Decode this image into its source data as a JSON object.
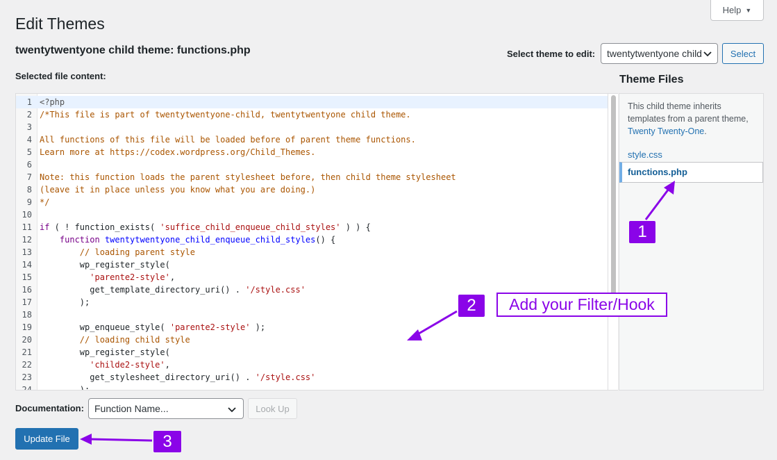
{
  "header": {
    "help_label": "Help",
    "page_title": "Edit Themes",
    "file_heading": "twentytwentyone child theme: functions.php",
    "select_theme_label": "Select theme to edit:",
    "select_theme_value": "twentytwentyone child theme",
    "select_button": "Select"
  },
  "editor": {
    "label": "Selected file content:",
    "lines": [
      {
        "n": "1",
        "spans": [
          {
            "c": "c-meta",
            "t": "<?php"
          }
        ]
      },
      {
        "n": "2",
        "spans": [
          {
            "c": "c-comment",
            "t": "/*This file is part of twentytwentyone-child, twentytwentyone child theme."
          }
        ]
      },
      {
        "n": "3",
        "spans": []
      },
      {
        "n": "4",
        "spans": [
          {
            "c": "c-comment",
            "t": "All functions of this file will be loaded before of parent theme functions."
          }
        ]
      },
      {
        "n": "5",
        "spans": [
          {
            "c": "c-comment",
            "t": "Learn more at https://codex.wordpress.org/Child_Themes."
          }
        ]
      },
      {
        "n": "6",
        "spans": []
      },
      {
        "n": "7",
        "spans": [
          {
            "c": "c-comment",
            "t": "Note: this function loads the parent stylesheet before, then child theme stylesheet"
          }
        ]
      },
      {
        "n": "8",
        "spans": [
          {
            "c": "c-comment",
            "t": "(leave it in place unless you know what you are doing.)"
          }
        ]
      },
      {
        "n": "9",
        "spans": [
          {
            "c": "c-comment",
            "t": "*/"
          }
        ]
      },
      {
        "n": "10",
        "spans": []
      },
      {
        "n": "11",
        "spans": [
          {
            "c": "c-kw",
            "t": "if"
          },
          {
            "c": "",
            "t": " ( ! function_exists( "
          },
          {
            "c": "c-str",
            "t": "'suffice_child_enqueue_child_styles'"
          },
          {
            "c": "",
            "t": " ) ) {"
          }
        ]
      },
      {
        "n": "12",
        "spans": [
          {
            "c": "",
            "t": "    "
          },
          {
            "c": "c-kw",
            "t": "function"
          },
          {
            "c": "",
            "t": " "
          },
          {
            "c": "c-def",
            "t": "twentytwentyone_child_enqueue_child_styles"
          },
          {
            "c": "",
            "t": "() {"
          }
        ]
      },
      {
        "n": "13",
        "spans": [
          {
            "c": "",
            "t": "        "
          },
          {
            "c": "c-comment",
            "t": "// loading parent style"
          }
        ]
      },
      {
        "n": "14",
        "spans": [
          {
            "c": "",
            "t": "        wp_register_style("
          }
        ]
      },
      {
        "n": "15",
        "spans": [
          {
            "c": "",
            "t": "          "
          },
          {
            "c": "c-str",
            "t": "'parente2-style'"
          },
          {
            "c": "",
            "t": ","
          }
        ]
      },
      {
        "n": "16",
        "spans": [
          {
            "c": "",
            "t": "          get_template_directory_uri() . "
          },
          {
            "c": "c-str",
            "t": "'/style.css'"
          }
        ]
      },
      {
        "n": "17",
        "spans": [
          {
            "c": "",
            "t": "        );"
          }
        ]
      },
      {
        "n": "18",
        "spans": []
      },
      {
        "n": "19",
        "spans": [
          {
            "c": "",
            "t": "        wp_enqueue_style( "
          },
          {
            "c": "c-str",
            "t": "'parente2-style'"
          },
          {
            "c": "",
            "t": " );"
          }
        ]
      },
      {
        "n": "20",
        "spans": [
          {
            "c": "",
            "t": "        "
          },
          {
            "c": "c-comment",
            "t": "// loading child style"
          }
        ]
      },
      {
        "n": "21",
        "spans": [
          {
            "c": "",
            "t": "        wp_register_style("
          }
        ]
      },
      {
        "n": "22",
        "spans": [
          {
            "c": "",
            "t": "          "
          },
          {
            "c": "c-str",
            "t": "'childe2-style'"
          },
          {
            "c": "",
            "t": ","
          }
        ]
      },
      {
        "n": "23",
        "spans": [
          {
            "c": "",
            "t": "          get_stylesheet_directory_uri() . "
          },
          {
            "c": "c-str",
            "t": "'/style.css'"
          }
        ]
      },
      {
        "n": "24",
        "spans": [
          {
            "c": "",
            "t": "        );"
          }
        ]
      }
    ]
  },
  "theme_files": {
    "title": "Theme Files",
    "note_prefix": "This child theme inherits templates from a parent theme, ",
    "note_link": "Twenty Twenty-One",
    "note_suffix": ".",
    "files": [
      "style.css",
      "functions.php"
    ]
  },
  "footer": {
    "doc_label": "Documentation:",
    "func_select_value": "Function Name...",
    "lookup_button": "Look Up",
    "update_button": "Update File"
  },
  "annotations": {
    "badge_1": "1",
    "badge_2": "2",
    "badge_3": "3",
    "hook_callout": "Add your Filter/Hook",
    "accent_color": "#8a04e8"
  }
}
